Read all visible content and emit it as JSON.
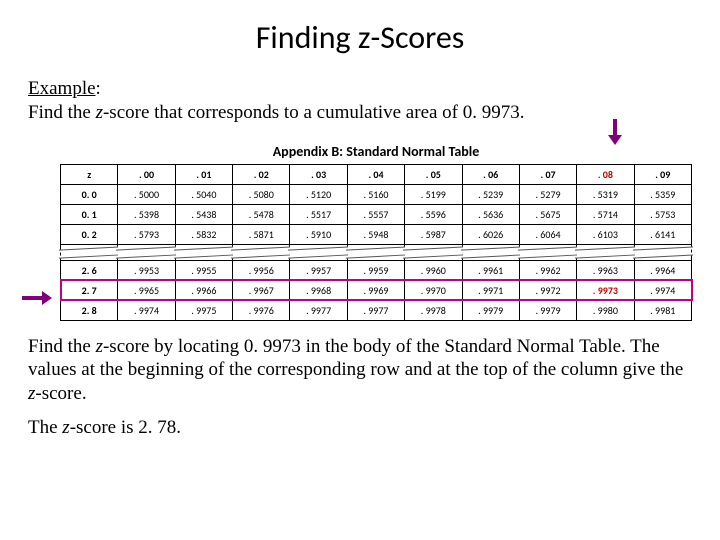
{
  "title": "Finding z-Scores",
  "example": {
    "label": "Example",
    "colon": ":",
    "text_1": "Find the ",
    "z": "z",
    "text_2": "-score that corresponds to a cumulative area of 0. 9973."
  },
  "table": {
    "caption": "Appendix B: Standard Normal Table",
    "headers": [
      "z",
      ". 00",
      ". 01",
      ". 02",
      ". 03",
      ". 04",
      ". 05",
      ". 06",
      ". 07",
      ". 08",
      ". 09"
    ],
    "rows_top": [
      [
        "0. 0",
        ". 5000",
        ". 5040",
        ". 5080",
        ". 5120",
        ". 5160",
        ". 5199",
        ". 5239",
        ". 5279",
        ". 5319",
        ". 5359"
      ],
      [
        "0. 1",
        ". 5398",
        ". 5438",
        ". 5478",
        ". 5517",
        ". 5557",
        ". 5596",
        ". 5636",
        ". 5675",
        ". 5714",
        ". 5753"
      ],
      [
        "0. 2",
        ". 5793",
        ". 5832",
        ". 5871",
        ". 5910",
        ". 5948",
        ". 5987",
        ". 6026",
        ". 6064",
        ". 6103",
        ". 6141"
      ]
    ],
    "rows_bottom": [
      [
        "2. 6",
        ". 9953",
        ". 9955",
        ". 9956",
        ". 9957",
        ". 9959",
        ". 9960",
        ". 9961",
        ". 9962",
        ". 9963",
        ". 9964"
      ],
      [
        "2. 7",
        ". 9965",
        ". 9966",
        ". 9967",
        ". 9968",
        ". 9969",
        ". 9970",
        ". 9971",
        ". 9972",
        ". 9973",
        ". 9974"
      ],
      [
        "2. 8",
        ". 9974",
        ". 9975",
        ". 9976",
        ". 9977",
        ". 9977",
        ". 9978",
        ". 9979",
        ". 9979",
        ". 9980",
        ". 9981"
      ]
    ],
    "highlight_col_index": 9,
    "highlight_row_index": 1
  },
  "footer": {
    "p1_a": "Find the ",
    "p1_z": "z",
    "p1_b": "-score by locating 0. 9973 in the body of the Standard Normal Table.  The values at the beginning of the corresponding row and at the top of the column give the ",
    "p1_z2": "z",
    "p1_c": "-score.",
    "p2_a": "The ",
    "p2_z": "z",
    "p2_b": "-score is 2. 78."
  }
}
